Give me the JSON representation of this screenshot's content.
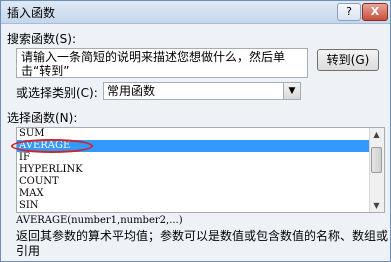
{
  "window": {
    "title": "插入函数",
    "help_label": "?",
    "close_label": "X"
  },
  "search": {
    "label": "搜索函数(S):",
    "value": "请输入一条简短的说明来描述您想做什么，然后单击“转到”",
    "go_label": "转到(G)"
  },
  "category": {
    "label": "或选择类别(C):",
    "selected": "常用函数"
  },
  "functions": {
    "label": "选择函数(N):",
    "items": [
      "SUM",
      "AVERAGE",
      "IF",
      "HYPERLINK",
      "COUNT",
      "MAX",
      "SIN"
    ],
    "selected": "AVERAGE"
  },
  "syntax": "AVERAGE(number1,number2,...)",
  "description": "返回其参数的算术平均值；参数可以是数值或包含数值的名称、数组或引用",
  "colors": {
    "selection": "#3399ff",
    "highlight_ring": "#d42222"
  }
}
